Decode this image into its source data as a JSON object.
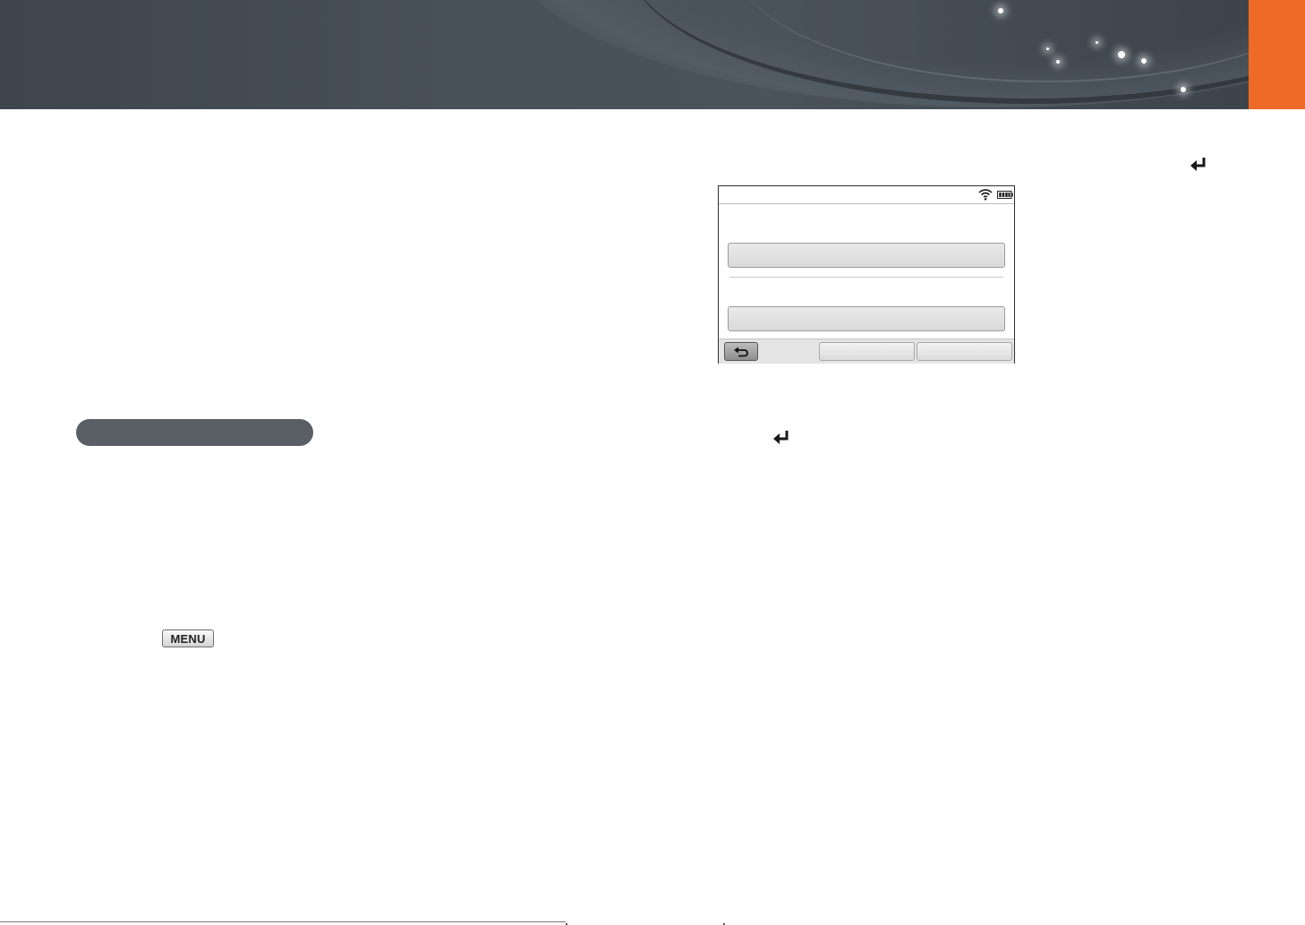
{
  "header": {
    "accent_color": "#ee6a27",
    "banner_color": "#454c53"
  },
  "left_column": {
    "section_pill_color": "#5a5f66",
    "menu_key_label": "MENU"
  },
  "enter_icons": [
    "enter-icon",
    "enter-icon"
  ],
  "camera_screen": {
    "status_icons": [
      "wifi-icon",
      "battery-icon"
    ],
    "back_icon": "back-arrow-icon"
  }
}
